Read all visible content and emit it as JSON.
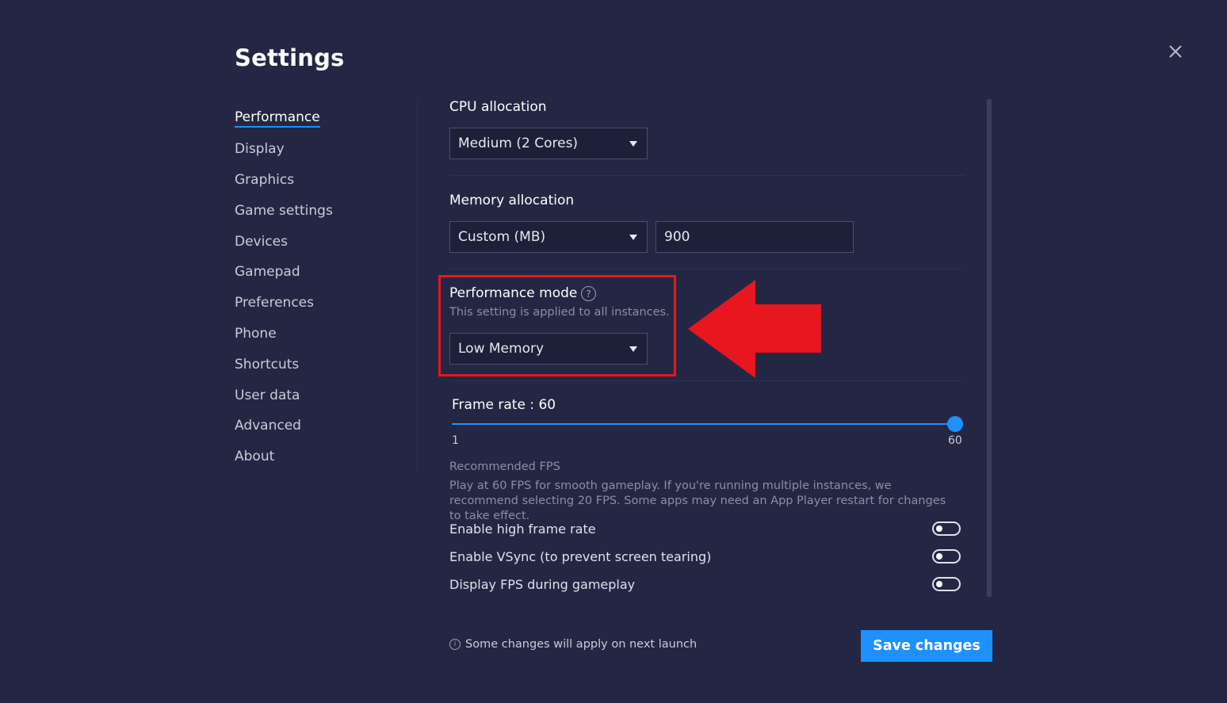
{
  "title": "Settings",
  "sidebar": {
    "items": [
      {
        "label": "Performance",
        "active": true
      },
      {
        "label": "Display"
      },
      {
        "label": "Graphics"
      },
      {
        "label": "Game settings"
      },
      {
        "label": "Devices"
      },
      {
        "label": "Gamepad"
      },
      {
        "label": "Preferences"
      },
      {
        "label": "Phone"
      },
      {
        "label": "Shortcuts"
      },
      {
        "label": "User data"
      },
      {
        "label": "Advanced"
      },
      {
        "label": "About"
      }
    ]
  },
  "cpu": {
    "label": "CPU allocation",
    "value": "Medium (2 Cores)"
  },
  "memory": {
    "label": "Memory allocation",
    "value": "Custom (MB)",
    "custom_value": "900"
  },
  "performance_mode": {
    "label": "Performance mode",
    "help_icon": "?",
    "note": "This setting is applied to all instances.",
    "value": "Low Memory"
  },
  "frame_rate": {
    "label": "Frame rate : 60",
    "min_label": "1",
    "max_label": "60",
    "value": 60,
    "min": 1,
    "max": 60
  },
  "recommended": {
    "title": "Recommended FPS",
    "text": "Play at 60 FPS for smooth gameplay. If you're running multiple instances, we recommend selecting 20 FPS. Some apps may need an App Player restart for changes to take effect."
  },
  "toggles": [
    {
      "label": "Enable high frame rate",
      "on": false
    },
    {
      "label": "Enable VSync (to prevent screen tearing)",
      "on": false
    },
    {
      "label": "Display FPS during gameplay",
      "on": false
    }
  ],
  "footer": {
    "info_icon": "i",
    "note": "Some changes will apply on next launch",
    "save_label": "Save changes"
  },
  "colors": {
    "background": "#232743",
    "accent": "#1e90ff",
    "highlight": "#e8161e"
  }
}
